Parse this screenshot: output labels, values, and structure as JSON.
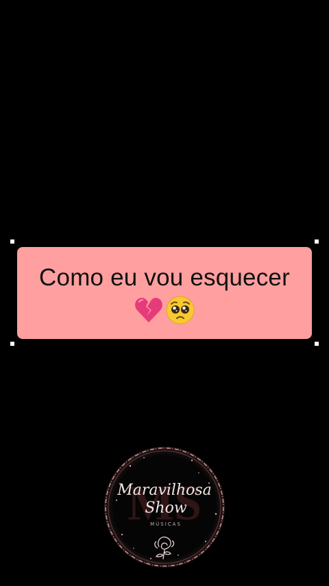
{
  "caption": {
    "text": "Como eu vou esquecer",
    "emojis": [
      "broken-heart-icon",
      "pleading-face-icon"
    ]
  },
  "logo": {
    "name_line1": "Maravilhosa",
    "name_line2": "Show",
    "tagline": "MÚSICAS",
    "monogram": "MS"
  },
  "colors": {
    "background": "#000000",
    "caption_bg": "#ff9f9f",
    "caption_text": "#111111",
    "logo_ring": "#c98c8c",
    "logo_fill": "#050505"
  }
}
